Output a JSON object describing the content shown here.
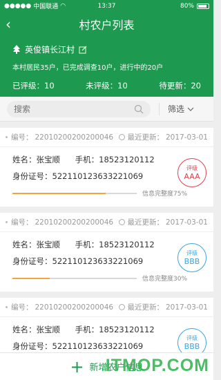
{
  "status_bar": {
    "carrier": "中国联通",
    "time": "13:37",
    "battery": "80%"
  },
  "nav": {
    "title": "村农户列表"
  },
  "hero": {
    "village": "英俊镇长江村",
    "summary": "本村居民35户，已完成调查10户，进行中的20户",
    "stats": [
      {
        "label": "已评级：",
        "value": "10"
      },
      {
        "label": "未评级：",
        "value": "10"
      },
      {
        "label": "待更新：",
        "value": "20"
      }
    ]
  },
  "search": {
    "placeholder": "搜索",
    "filter_label": "筛选"
  },
  "cards": [
    {
      "id_label": "编号：",
      "id": "22010200200200046",
      "updated_label": "最近更新：",
      "updated": "2017-03-01",
      "name_label": "姓名：",
      "name": "张宝顺",
      "phone_label": "手机：",
      "phone": "18523120112",
      "idcard_label": "身份证号：",
      "idcard": "522110123633221069",
      "rating_label": "评级",
      "rating": "AAA",
      "rating_color": "#e0424f",
      "progress": 75,
      "progress_text": "信息完整度75%"
    },
    {
      "id_label": "编号：",
      "id": "22010200200200046",
      "updated_label": "最近更新：",
      "updated": "2017-03-01",
      "name_label": "姓名：",
      "name": "张宝顺",
      "phone_label": "手机：",
      "phone": "18523120112",
      "idcard_label": "身份证号：",
      "idcard": "522110123633221069",
      "rating_label": "评级",
      "rating": "BBB",
      "rating_color": "#3aa6e0",
      "progress": 30,
      "progress_text": "信息完整度30%"
    },
    {
      "id_label": "编号：",
      "id": "22010200200200046",
      "updated_label": "最近更新：",
      "updated": "2017-03-01",
      "name_label": "姓名：",
      "name": "张宝顺",
      "phone_label": "手机：",
      "phone": "18523120112",
      "idcard_label": "身份证号：",
      "idcard": "522110123633221069",
      "rating_label": "评级",
      "rating": "BBB",
      "rating_color": "#3aa6e0",
      "progress": 0,
      "progress_text": ""
    }
  ],
  "bottom": {
    "add_label": "新增农户信息"
  },
  "watermark": "ITMOP.COM",
  "colors": {
    "brand": "#1d9a4f",
    "progress": "#f2a53a"
  }
}
